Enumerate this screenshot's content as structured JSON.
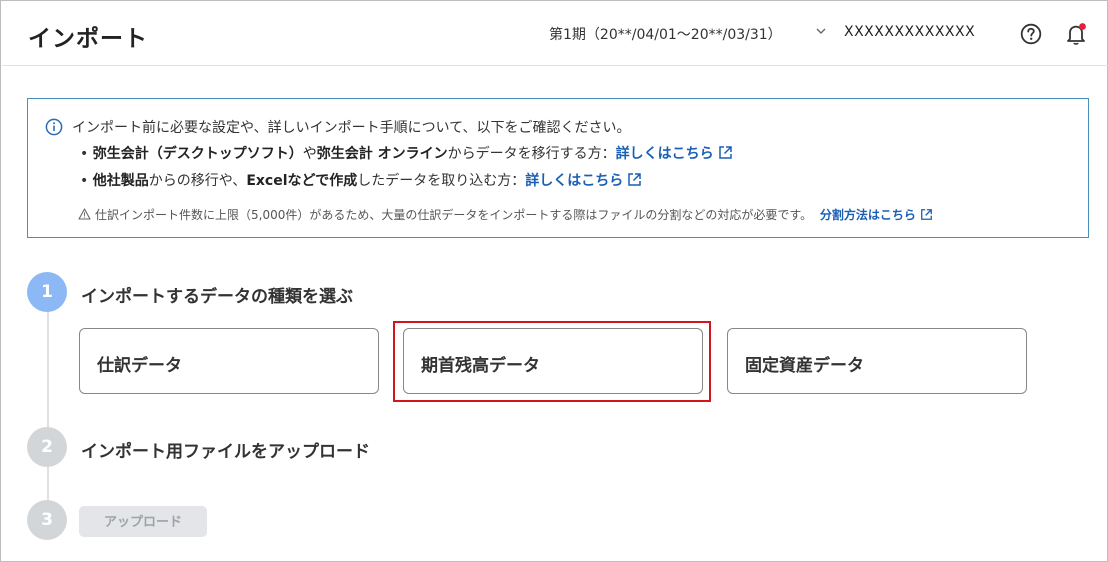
{
  "header": {
    "title": "インポート",
    "period": "第1期（20**/04/01〜20**/03/31）",
    "company": "XXXXXXXXXXXXX"
  },
  "info": {
    "lead": "インポート前に必要な設定や、詳しいインポート手順について、以下をご確認ください。",
    "bullet1": {
      "part1": "弥生会計（デスクトップソフト）",
      "part2": "や",
      "part3": "弥生会計 オンライン",
      "part4": "からデータを移行する方：",
      "link": "詳しくはこちら"
    },
    "bullet2": {
      "part1": "他社製品",
      "part2": "からの移行や、",
      "part3": "Excelなどで作成",
      "part4": "したデータを取り込む方：",
      "link": "詳しくはこちら"
    },
    "note": "仕訳インポート件数に上限（5,000件）があるため、大量の仕訳データをインポートする際はファイルの分割などの対応が必要です。",
    "note_link": "分割方法はこちら"
  },
  "steps": [
    {
      "number": "1",
      "title": "インポートするデータの種類を選ぶ"
    },
    {
      "number": "2",
      "title": "インポート用ファイルをアップロード"
    },
    {
      "number": "3",
      "button": "アップロード"
    }
  ],
  "choices": [
    "仕訳データ",
    "期首残高データ",
    "固定資産データ"
  ],
  "colors": {
    "accent_link": "#1a5fb4",
    "info_border": "#4a90b8",
    "step_active": "#8cb8f5",
    "step_inactive": "#d3d6d9",
    "highlight": "#d0161c",
    "notification_dot": "#e0213a"
  },
  "icons": {
    "period_dropdown": "chevron-down-icon",
    "help": "help-circle-icon",
    "notifications": "bell-icon",
    "info": "info-icon",
    "external": "external-link-icon",
    "warning": "warning-icon"
  }
}
